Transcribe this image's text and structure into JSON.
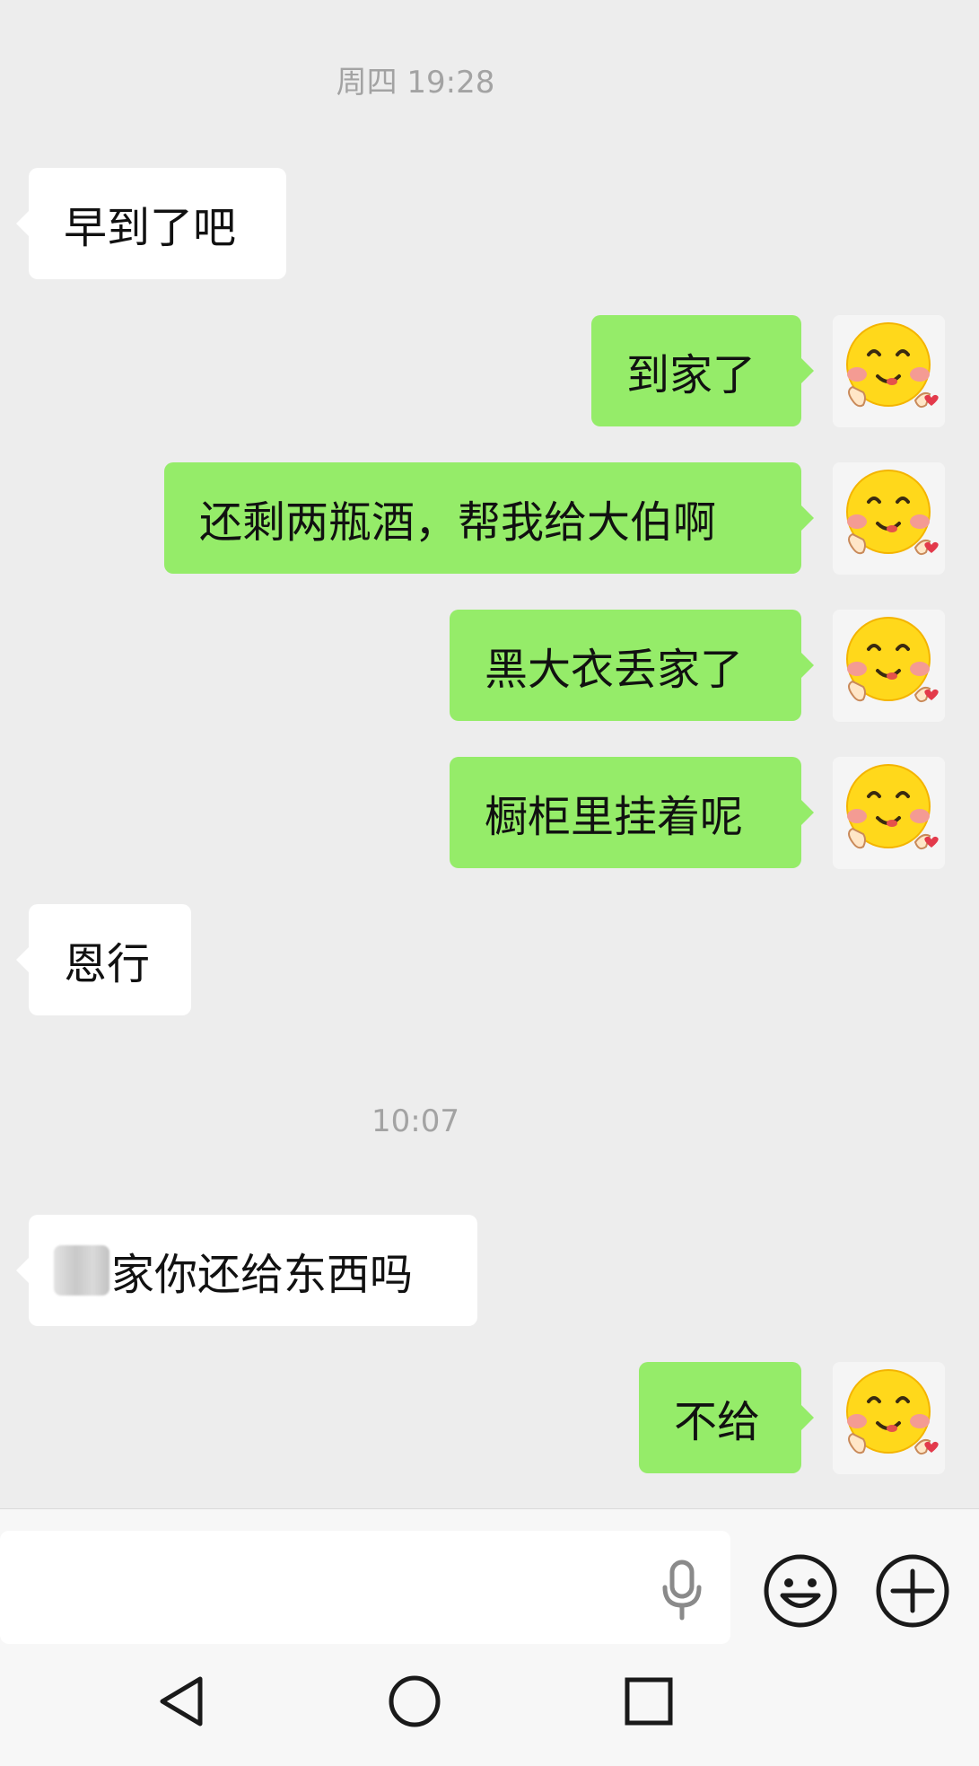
{
  "chat": {
    "timestamps": [
      "周四 19:28",
      "10:07"
    ],
    "messages": [
      {
        "side": "left",
        "text": "早到了吧"
      },
      {
        "side": "right",
        "text": "到家了"
      },
      {
        "side": "right",
        "text": "还剩两瓶酒，帮我给大伯啊"
      },
      {
        "side": "right",
        "text": "黑大衣丢家了"
      },
      {
        "side": "right",
        "text": "橱柜里挂着呢"
      },
      {
        "side": "left",
        "text": "恩行"
      },
      {
        "side": "left",
        "text": "家你还给东西吗",
        "redacted_prefix": true
      },
      {
        "side": "right",
        "text": "不给"
      }
    ],
    "avatar_icon": "smiling-emoji-avatar-icon",
    "colors": {
      "background": "#EDEDED",
      "sent_bubble": "#95EC69",
      "received_bubble": "#FFFFFF"
    }
  },
  "input_bar": {
    "placeholder": "",
    "icons": [
      "microphone-icon",
      "emoji-icon",
      "plus-icon"
    ]
  },
  "nav_bar": {
    "icons": [
      "back-triangle-icon",
      "home-circle-icon",
      "recents-square-icon"
    ]
  }
}
